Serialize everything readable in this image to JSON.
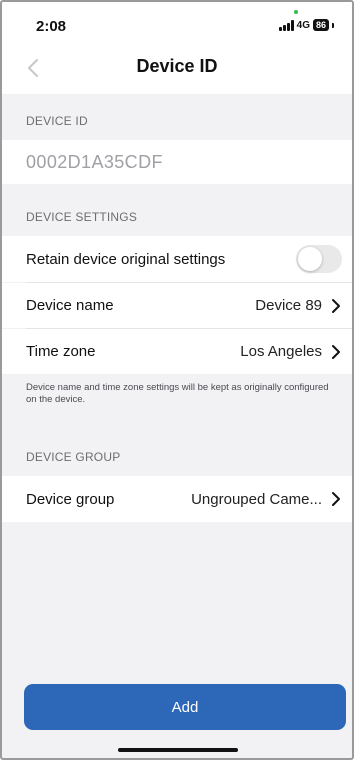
{
  "status_bar": {
    "time": "2:08",
    "network": "4G",
    "battery": "86"
  },
  "nav": {
    "title": "Device ID"
  },
  "device_id_section": {
    "header": "DEVICE ID",
    "value": "0002D1A35CDF"
  },
  "device_settings_section": {
    "header": "DEVICE SETTINGS",
    "retain_label": "Retain device original settings",
    "retain_enabled": false,
    "device_name_label": "Device name",
    "device_name_value": "Device 89",
    "time_zone_label": "Time zone",
    "time_zone_value": "Los Angeles",
    "note": "Device name and time zone settings will be kept as originally configured on the device."
  },
  "device_group_section": {
    "header": "DEVICE GROUP",
    "group_label": "Device group",
    "group_value": "Ungrouped Came..."
  },
  "actions": {
    "add_label": "Add"
  },
  "colors": {
    "accent": "#2d68b8",
    "background": "#f2f2f4",
    "toggle_off": "#e9e9ea"
  }
}
